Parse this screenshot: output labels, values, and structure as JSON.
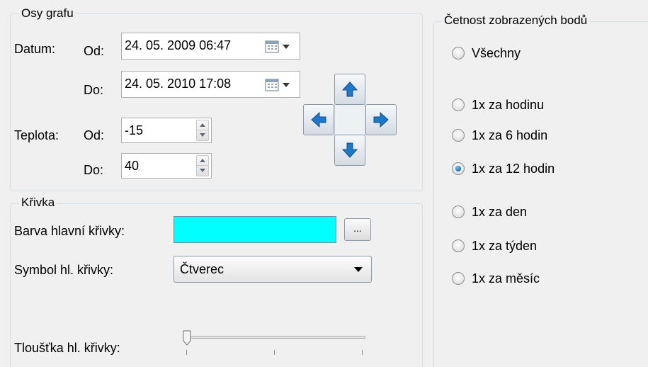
{
  "axes_group": {
    "title": "Osy grafu",
    "date_label": "Datum:",
    "from_label": "Od:",
    "to_label": "Do:",
    "date_from": "24. 05. 2009 06:47",
    "date_to": "24. 05. 2010 17:08",
    "temp_label": "Teplota:",
    "temp_from": "-15",
    "temp_to": "40"
  },
  "curve_group": {
    "title": "Křivka",
    "color_label": "Barva hlavní křivky:",
    "color_value": "#00ffff",
    "ellipsis_label": "...",
    "symbol_label": "Symbol hl. křivky:",
    "symbol_value": "Čtverec",
    "thickness_label": "Tloušťka hl. křivky:",
    "thickness_level": 0
  },
  "frequency_group": {
    "title": "Četnost zobrazených bodů",
    "options": [
      {
        "label": "Všechny",
        "checked": false
      },
      {
        "label": "1x za hodinu",
        "checked": false
      },
      {
        "label": "1x za 6 hodin",
        "checked": false
      },
      {
        "label": "1x za 12 hodin",
        "checked": true
      },
      {
        "label": "1x za den",
        "checked": false
      },
      {
        "label": "1x za týden",
        "checked": false
      },
      {
        "label": "1x za měsíc",
        "checked": false
      }
    ]
  },
  "icons": {
    "calendar": "calendar-icon",
    "nav_up": "arrow-up-icon",
    "nav_left": "arrow-left-icon",
    "nav_right": "arrow-right-icon",
    "nav_down": "arrow-down-icon"
  },
  "colors": {
    "nav_arrow": "#1e78c8",
    "group_border": "#d5dfe5"
  }
}
